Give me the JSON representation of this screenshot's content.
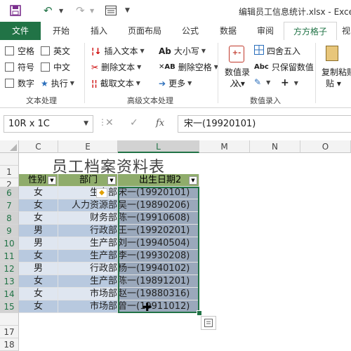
{
  "window": {
    "title": "编辑员工信息统计.xlsx - Exce"
  },
  "ribbon_tabs": [
    "文件",
    "开始",
    "插入",
    "页面布局",
    "公式",
    "数据",
    "审阅",
    "方方格子",
    "视"
  ],
  "ribbon": {
    "text_processing": {
      "checkboxes": [
        "空格",
        "英文",
        "符号",
        "中文",
        "数字"
      ],
      "execute_label": "执行",
      "group_label": "文本处理"
    },
    "advanced_text": {
      "insert_text": "插入文本",
      "delete_text": "删除文本",
      "extract_text": "截取文本",
      "change_case": "大小写",
      "delete_spaces": "删除空格",
      "more": "更多",
      "group_label": "高级文本处理"
    },
    "numeric_entry": {
      "numeric_entry_label": "数值录入",
      "round_label": "四舍五入",
      "keep_values_label": "只保留数值",
      "group_label": "数值录入"
    },
    "paste": {
      "label": "复制粘贴"
    }
  },
  "formula_bar": {
    "name_box": "10R x 1C",
    "fx_label": "fx",
    "formula": "宋一(19920101)"
  },
  "sheet": {
    "columns": [
      "C",
      "E",
      "L",
      "M",
      "N",
      "O"
    ],
    "title": "员工档案资料表",
    "header_row": [
      "性别",
      "部门",
      "出生日期2"
    ],
    "rows": [
      {
        "row": "6",
        "gender": "女",
        "dept": "生产部",
        "birth": "宋一(19920101)"
      },
      {
        "row": "7",
        "gender": "女",
        "dept": "人力资源部",
        "birth": "吴一(19890206)"
      },
      {
        "row": "8",
        "gender": "女",
        "dept": "财务部",
        "birth": "陈一(19910608)"
      },
      {
        "row": "9",
        "gender": "男",
        "dept": "行政部",
        "birth": "王一(19920201)"
      },
      {
        "row": "10",
        "gender": "男",
        "dept": "生产部",
        "birth": "刘一(19940504)"
      },
      {
        "row": "11",
        "gender": "女",
        "dept": "生产部",
        "birth": "李一(19930208)"
      },
      {
        "row": "12",
        "gender": "男",
        "dept": "行政部",
        "birth": "杨一(19940102)"
      },
      {
        "row": "13",
        "gender": "女",
        "dept": "生产部",
        "birth": "陈一(19891201)"
      },
      {
        "row": "14",
        "gender": "女",
        "dept": "市场部",
        "birth": "赵一(19880316)"
      },
      {
        "row": "15",
        "gender": "女",
        "dept": "市场部",
        "birth": "曾一(19911012)"
      }
    ],
    "extra_rows": [
      "1",
      "2",
      "17",
      "18",
      "19"
    ]
  },
  "colors": {
    "excel_green": "#217346",
    "table_header": "#8fac6b",
    "band_light": "#dfe6f0",
    "band_dark": "#b8c9df",
    "selection": "#9aa8bb"
  }
}
